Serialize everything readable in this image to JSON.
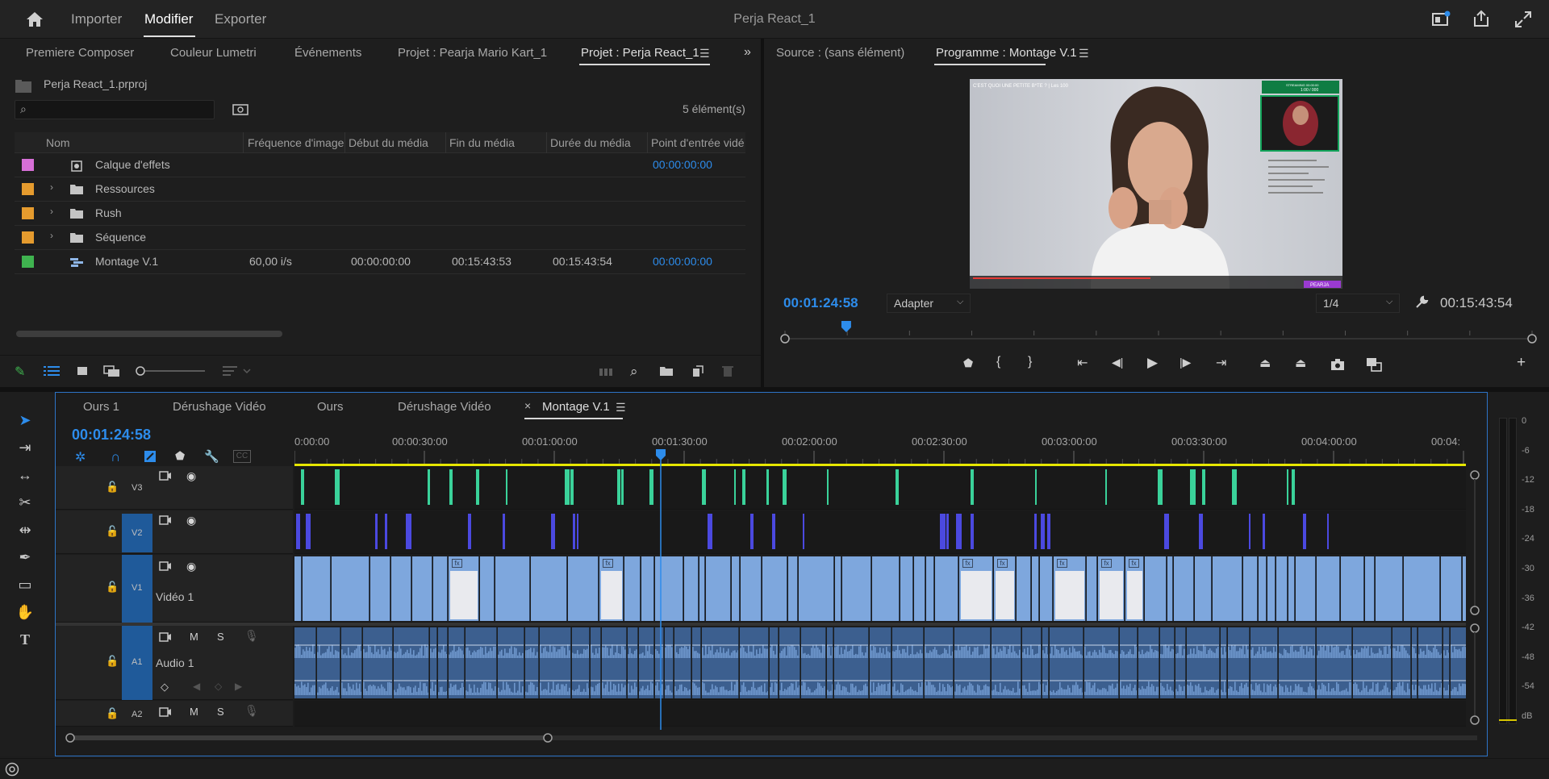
{
  "topbar": {
    "menu": [
      "Importer",
      "Modifier",
      "Exporter"
    ],
    "active_menu": "Modifier",
    "title": "Perja React_1"
  },
  "project_panel": {
    "tabs": [
      "Premiere Composer",
      "Couleur Lumetri",
      "Événements",
      "Projet : Pearja Mario Kart_1",
      "Projet : Perja React_1"
    ],
    "active_tab": "Projet : Perja React_1",
    "project_file": "Perja React_1.prproj",
    "search_placeholder": "",
    "item_count": "5 élément(s)",
    "columns": [
      "Nom",
      "Fréquence d'image",
      "Début du média",
      "Fin du média",
      "Durée du média",
      "Point d'entrée vidé"
    ],
    "rows": [
      {
        "swatch": "#d76fd7",
        "name": "Calque d'effets",
        "type": "effects",
        "expand": false,
        "fps": "",
        "start": "",
        "end": "",
        "duration": "",
        "in_point": "00:00:00:00"
      },
      {
        "swatch": "#e59b2e",
        "name": "Ressources",
        "type": "folder",
        "expand": true,
        "fps": "",
        "start": "",
        "end": "",
        "duration": "",
        "in_point": ""
      },
      {
        "swatch": "#e59b2e",
        "name": "Rush",
        "type": "folder",
        "expand": true,
        "fps": "",
        "start": "",
        "end": "",
        "duration": "",
        "in_point": ""
      },
      {
        "swatch": "#e59b2e",
        "name": "Séquence",
        "type": "folder",
        "expand": true,
        "fps": "",
        "start": "",
        "end": "",
        "duration": "",
        "in_point": ""
      },
      {
        "swatch": "#3fb34f",
        "name": "Montage V.1",
        "type": "sequence",
        "expand": false,
        "fps": "60,00 i/s",
        "start": "00:00:00:00",
        "end": "00:15:43:53",
        "duration": "00:15:43:54",
        "in_point": "00:00:00:00"
      }
    ]
  },
  "program_panel": {
    "tabs": [
      "Source : (sans élément)",
      "Programme : Montage V.1"
    ],
    "active_tab": "Programme : Montage V.1",
    "current_time": "00:01:24:58",
    "fit": "Adapter",
    "resolution": "1/4",
    "duration": "00:15:43:54",
    "video_caption": "C'EST QUOI UNE PETITE B*TE ? | Les 100",
    "stream_badge": "PEARJA",
    "stream_header": "STREAMING 00:00:00",
    "stream_sub": "1:00 / 000",
    "playhead_fraction": 0.082
  },
  "timeline": {
    "tabs": [
      "Ours 1",
      "Dérushage Vidéo",
      "Ours",
      "Dérushage Vidéo",
      "Montage V.1"
    ],
    "active_tab": "Montage V.1",
    "timecode": "00:01:24:58",
    "ruler": [
      "0:00:00",
      "00:00:30:00",
      "00:01:00:00",
      "00:01:30:00",
      "00:02:00:00",
      "00:02:30:00",
      "00:03:00:00",
      "00:03:30:00",
      "00:04:00:00",
      "00:04:"
    ],
    "tracks": {
      "v3": "V3",
      "v2": "V2",
      "v1": {
        "tag": "V1",
        "name": "Vidéo 1"
      },
      "a1": {
        "tag": "A1",
        "name": "Audio 1"
      },
      "a2": "A2",
      "mute": "M",
      "solo": "S"
    },
    "playhead_fraction": 0.313
  },
  "meters": {
    "scale": [
      "0",
      "-6",
      "-12",
      "-18",
      "-24",
      "-30",
      "-36",
      "-42",
      "-48",
      "-54",
      "dB"
    ]
  },
  "colors": {
    "accent_blue": "#2d8ceb",
    "v3_clip": "#3ad29a",
    "v2_clip": "#4b49e0",
    "v1_clip": "#7ea7dd",
    "audio_clip": "#6e97cc"
  }
}
